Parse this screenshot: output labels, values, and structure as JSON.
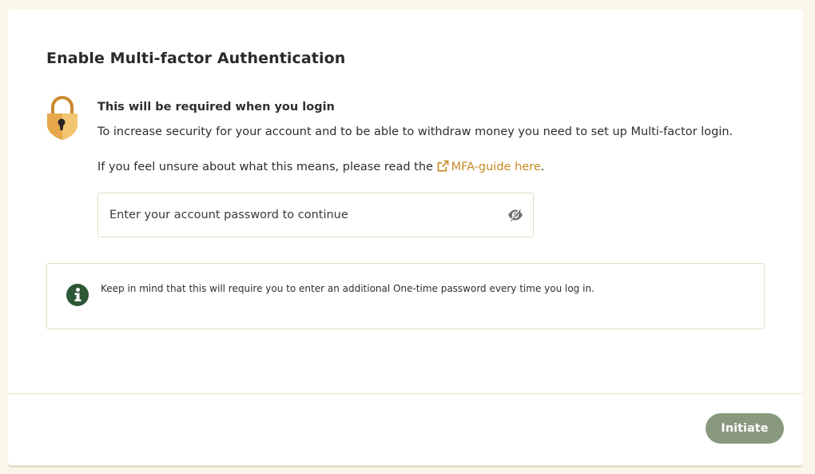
{
  "dialog": {
    "title": "Enable Multi-factor Authentication",
    "lock_icon": "padlock-icon",
    "heading": "This will be required when you login",
    "description": "To increase security for your account and to be able to withdraw money you need to set up Multi-factor login.",
    "guide_prefix": "If you feel unsure about what this means, please read the",
    "guide_link_icon": "external-link-icon",
    "guide_link_label": "MFA-guide here",
    "guide_suffix": ".",
    "password": {
      "value": "",
      "placeholder": "Enter your account password to continue",
      "toggle_icon": "eye-icon"
    },
    "notice": {
      "icon": "info-icon",
      "text": "Keep in mind that this will require you to enter an additional One-time password every time you log in."
    },
    "initiate_label": "Initiate"
  },
  "colors": {
    "background": "#faf6e9",
    "link": "#c98a23",
    "lock_gold": "#e6a84a",
    "info_green": "#2e5736",
    "button": "#88997e"
  }
}
